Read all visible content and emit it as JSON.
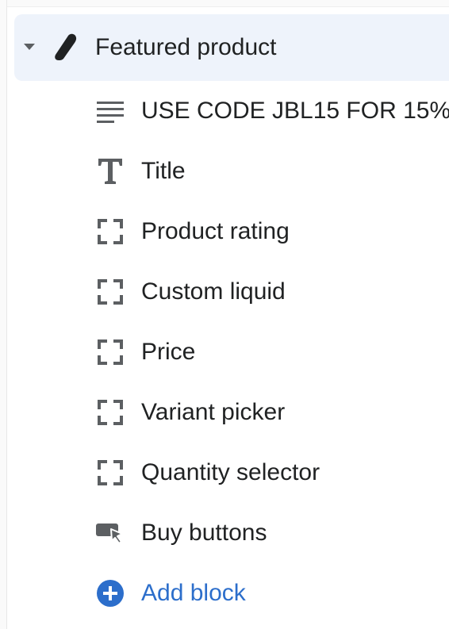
{
  "section": {
    "title": "Featured product",
    "icon": "featured-product-icon"
  },
  "blocks": [
    {
      "label": "USE CODE JBL15 FOR 15% ...",
      "icon": "text-lines-icon"
    },
    {
      "label": "Title",
      "icon": "title-T-icon"
    },
    {
      "label": "Product rating",
      "icon": "dashed-square-icon"
    },
    {
      "label": "Custom liquid",
      "icon": "dashed-square-icon"
    },
    {
      "label": "Price",
      "icon": "dashed-square-icon"
    },
    {
      "label": "Variant picker",
      "icon": "dashed-square-icon"
    },
    {
      "label": "Quantity selector",
      "icon": "dashed-square-icon"
    },
    {
      "label": "Buy buttons",
      "icon": "buy-buttons-icon"
    }
  ],
  "add_block": {
    "label": "Add block",
    "icon": "plus-circle-icon"
  },
  "colors": {
    "header_bg": "#eef3fb",
    "text": "#202223",
    "icon": "#5c5f62",
    "accent": "#2c6ecb"
  }
}
